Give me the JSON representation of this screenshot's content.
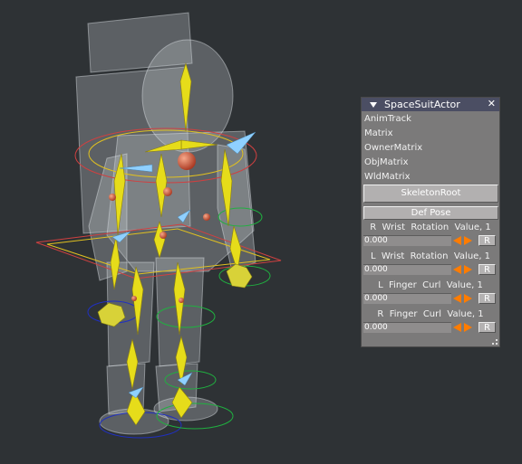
{
  "panel": {
    "title": "SpaceSuitActor",
    "close_glyph": "✕",
    "properties": [
      "AnimTrack",
      "Matrix",
      "OwnerMatrix",
      "ObjMatrix",
      "WldMatrix"
    ],
    "skeleton_button": "SkeletonRoot",
    "def_pose_button": "Def Pose",
    "controls": [
      {
        "label": "R  Wrist  Rotation  Value, 1",
        "value": "0.000",
        "reset": "R"
      },
      {
        "label": "L  Wrist  Rotation  Value, 1",
        "value": "0.000",
        "reset": "R"
      },
      {
        "label": "L  Finger  Curl  Value, 1",
        "value": "0.000",
        "reset": "R"
      },
      {
        "label": "R  Finger  Curl  Value, 1",
        "value": "0.000",
        "reset": "R"
      }
    ]
  },
  "colors": {
    "background": "#2e3235",
    "panel": "#7b7a7a",
    "titlebar": "#4b4e63",
    "arrow": "#ff7c00",
    "bone": "#e6dc1a",
    "joint": "#d85a3a",
    "control_cyan": "#8fd0ff"
  },
  "icons": {
    "collapse": "triangle-down-icon",
    "close": "close-icon",
    "step": "orange-arrows-icon",
    "resize": "resize-grip-icon"
  }
}
